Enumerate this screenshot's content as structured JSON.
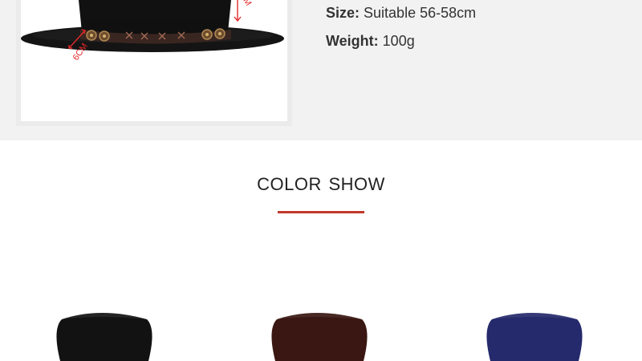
{
  "specs": {
    "size": {
      "label": "Size:",
      "value": "Suitable 56-58cm"
    },
    "weight": {
      "label": "Weight:",
      "value": "100g"
    }
  },
  "product_image": {
    "brim_measure_label": "6CM",
    "crown_measure_label": "M"
  },
  "color_show": {
    "title": "COLOR SHOW",
    "accent_color": "#c0392b",
    "swatches": [
      {
        "color": "#121212"
      },
      {
        "color": "#3a1712"
      },
      {
        "color": "#242a6b"
      }
    ]
  }
}
